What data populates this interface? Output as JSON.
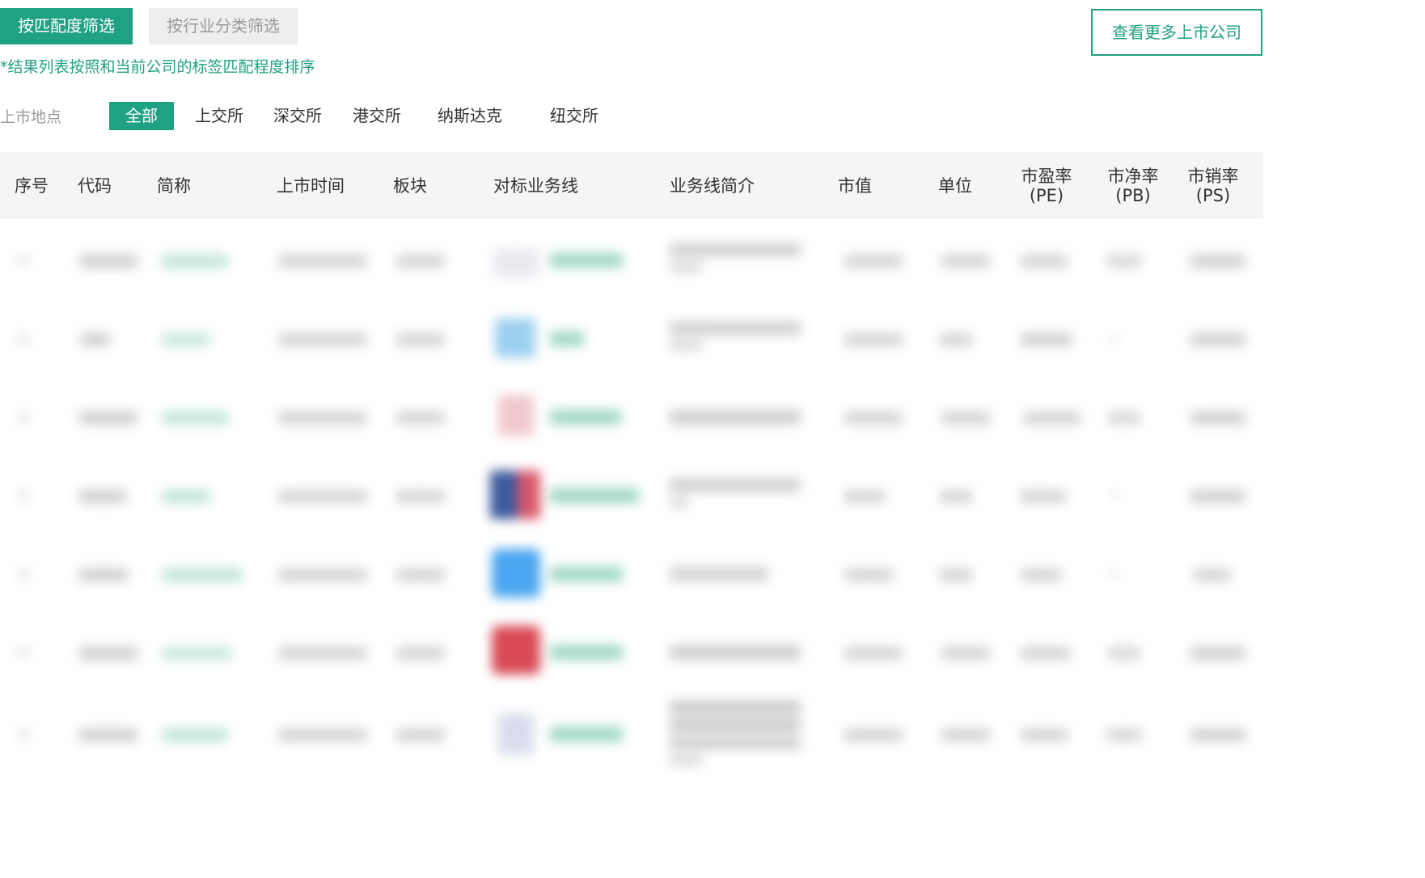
{
  "filters": {
    "match_tab": "按匹配度筛选",
    "industry_tab": "按行业分类筛选"
  },
  "more_button": "查看更多上市公司",
  "note": "*结果列表按照和当前公司的标签匹配程度排序",
  "location": {
    "label": "上市地点",
    "options": [
      "全部",
      "上交所",
      "深交所",
      "港交所",
      "纳斯达克",
      "纽交所"
    ],
    "selected": "全部"
  },
  "table": {
    "headers": {
      "index": "序号",
      "code": "代码",
      "short_name": "简称",
      "list_date": "上市时间",
      "board": "板块",
      "benchmark": "对标业务线",
      "intro": "业务线简介",
      "market_cap": "市值",
      "unit": "单位",
      "pe_line1": "市盈率",
      "pe_line2": "(PE)",
      "pb_line1": "市净率",
      "pb_line2": "(PB)",
      "ps_line1": "市销率",
      "ps_line2": "(PS)"
    },
    "rows_blurred": true
  },
  "colors": {
    "accent": "#1fa183",
    "header_bg": "#f5f5f5",
    "inactive_tab_bg": "#eeeeee"
  }
}
